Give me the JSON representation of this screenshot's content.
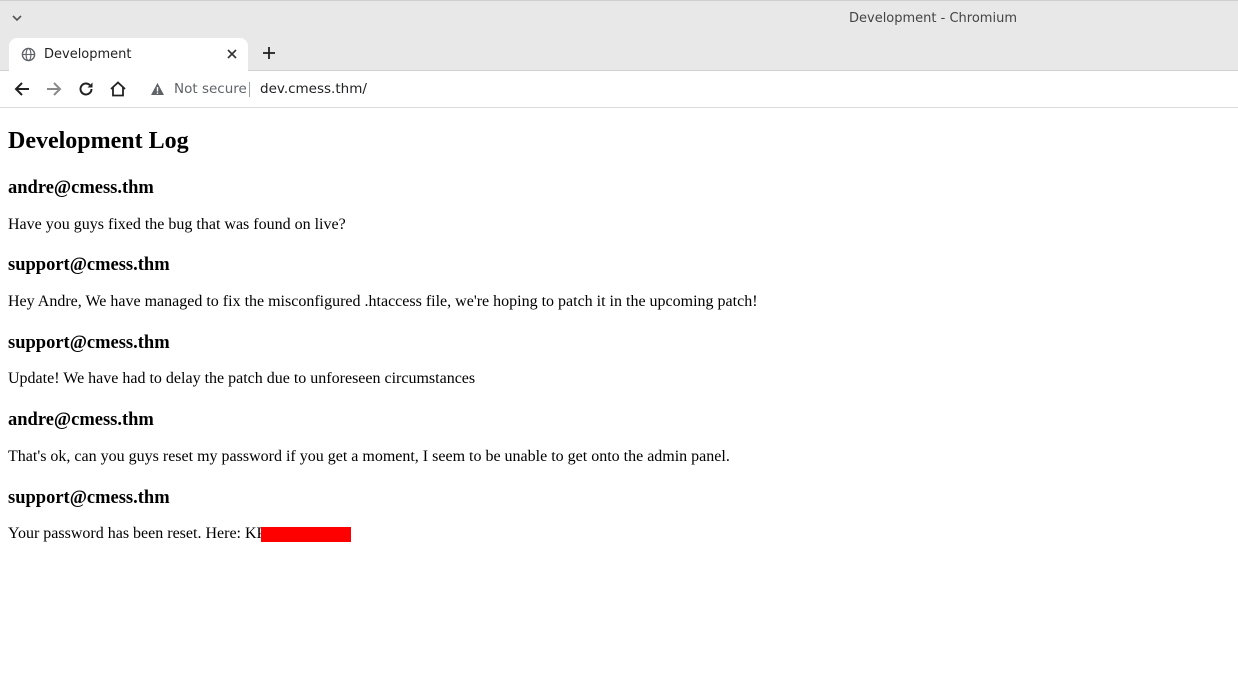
{
  "browser": {
    "window_title": "Development - Chromium",
    "tab": {
      "label": "Development",
      "favicon": "globe-icon"
    },
    "address_bar": {
      "security_label": "Not secure",
      "url": "dev.cmess.thm/"
    },
    "icons": {
      "menu": "chevron-down-icon",
      "close_tab": "close-icon",
      "new_tab": "plus-icon",
      "back": "arrow-left-icon",
      "forward": "arrow-right-icon",
      "reload": "reload-icon",
      "home": "home-icon",
      "security": "warning-icon"
    }
  },
  "page": {
    "heading": "Development Log",
    "entries": [
      {
        "author": "andre@cmess.thm",
        "message": "Have you guys fixed the bug that was found on live?"
      },
      {
        "author": "support@cmess.thm",
        "message": "Hey Andre, We have managed to fix the misconfigured .htaccess file, we're hoping to patch it in the upcoming patch!"
      },
      {
        "author": "support@cmess.thm",
        "message": "Update! We have had to delay the patch due to unforeseen circumstances"
      },
      {
        "author": "andre@cmess.thm",
        "message": "That's ok, can you guys reset my password if you get a moment, I seem to be unable to get onto the admin panel."
      },
      {
        "author": "support@cmess.thm",
        "message_prefix": "Your password has been reset. Here: ",
        "message_visible": "KP",
        "redaction_color": "#ff0000"
      }
    ]
  }
}
